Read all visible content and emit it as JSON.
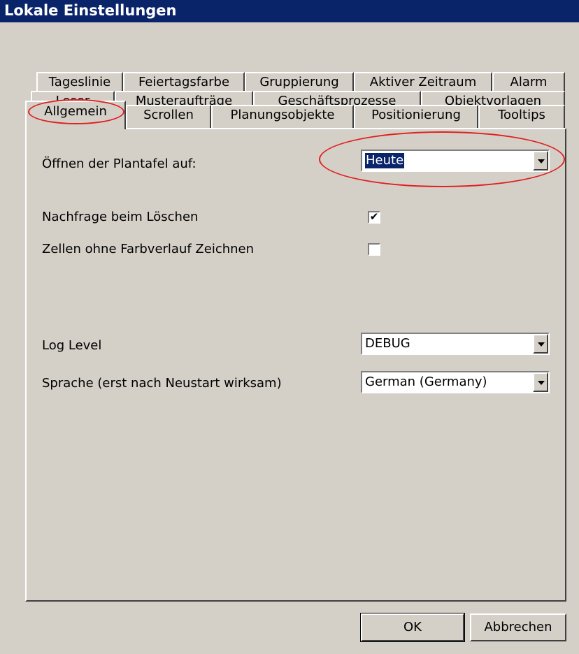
{
  "window": {
    "title": "Lokale Einstellungen"
  },
  "tabs": {
    "row1": [
      "Tageslinie",
      "Feiertagsfarbe",
      "Gruppierung",
      "Aktiver Zeitraum",
      "Alarm"
    ],
    "row2": [
      "Leser",
      "Musteraufträge",
      "Geschäftsprozesse",
      "Objektvorlagen"
    ],
    "row3": [
      "Allgemein",
      "Scrollen",
      "Planungsobjekte",
      "Positionierung",
      "Tooltips"
    ],
    "active": "Allgemein"
  },
  "general": {
    "open_label": "Öffnen der Plantafel auf:",
    "open_value": "Heute",
    "confirm_delete_label": "Nachfrage beim Löschen",
    "confirm_delete_checked": true,
    "no_gradient_label": "Zellen ohne Farbverlauf Zeichnen",
    "no_gradient_checked": false,
    "log_level_label": "Log Level",
    "log_level_value": "DEBUG",
    "language_label": "Sprache (erst nach Neustart wirksam)",
    "language_value": "German (Germany)",
    "check_mark": "✔"
  },
  "buttons": {
    "ok": "OK",
    "cancel": "Abbrechen"
  },
  "colors": {
    "title_bar": "#0a246a",
    "annotation": "#e02020",
    "face": "#d4d0c8"
  }
}
